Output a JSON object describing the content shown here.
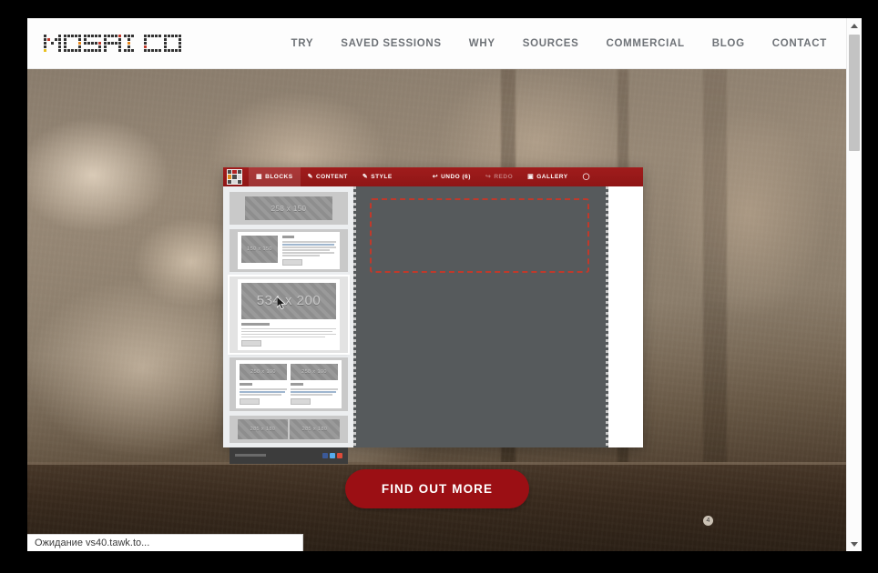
{
  "site": {
    "logo_text": "MOSAICO",
    "logo_colors": {
      "dark": "#333333",
      "red": "#c0392b",
      "orange": "#e8861a",
      "yellow": "#e8c020"
    },
    "nav": [
      {
        "label": "TRY"
      },
      {
        "label": "SAVED SESSIONS"
      },
      {
        "label": "WHY"
      },
      {
        "label": "SOURCES"
      },
      {
        "label": "COMMERCIAL"
      },
      {
        "label": "BLOG"
      },
      {
        "label": "CONTACT"
      }
    ]
  },
  "hero": {
    "cta_label": "FIND OUT MORE",
    "cta_color": "#9b0f14",
    "badge_label": "4"
  },
  "app_shot": {
    "toolbar": {
      "brand_icon": "mosaic-logo-icon",
      "items": [
        {
          "label": "BLOCKS",
          "icon": "blocks-icon",
          "active": true,
          "disabled": false
        },
        {
          "label": "CONTENT",
          "icon": "pencil-icon",
          "active": false,
          "disabled": false
        },
        {
          "label": "STYLE",
          "icon": "pencil-icon",
          "active": false,
          "disabled": false
        }
      ],
      "actions": [
        {
          "label": "UNDO (6)",
          "icon": "undo-arrow-icon",
          "disabled": false
        },
        {
          "label": "REDO",
          "icon": "redo-arrow-icon",
          "disabled": true
        },
        {
          "label": "GALLERY",
          "icon": "image-icon",
          "disabled": false
        },
        {
          "label": "",
          "icon": "preview-circle-icon",
          "disabled": false
        }
      ],
      "bg_color": "#9a1919"
    },
    "sidebar": {
      "blocks": [
        {
          "name": "one-image-block",
          "placeholder": "258 x 150",
          "selected": false
        },
        {
          "name": "image-text-block",
          "placeholder": "150 x 150",
          "selected": false,
          "title": "Title"
        },
        {
          "name": "hero-section-block",
          "placeholder": "534 x 200",
          "selected": true,
          "title": "Section Title"
        },
        {
          "name": "two-column-block",
          "placeholder_left": "258 x 100",
          "placeholder_right": "258 x 100",
          "title_left": "Title",
          "title_right": "Title",
          "selected": false
        },
        {
          "name": "two-image-block",
          "placeholder_left": "285 x 180",
          "placeholder_right": "285 x 180",
          "selected": false
        },
        {
          "name": "footer-block",
          "selected": false,
          "socials": [
            "#3b5998",
            "#55acee",
            "#dd4b39"
          ]
        }
      ],
      "cursor": "arrow-cursor"
    },
    "canvas": {
      "dropzone_color": "#c0392b",
      "sheet_color": "#565a5c"
    }
  },
  "statusbar": {
    "text": "Ожидание vs40.tawk.to..."
  },
  "scrollbar": {
    "up_icon": "scroll-up-arrow-icon",
    "down_icon": "scroll-down-arrow-icon"
  }
}
